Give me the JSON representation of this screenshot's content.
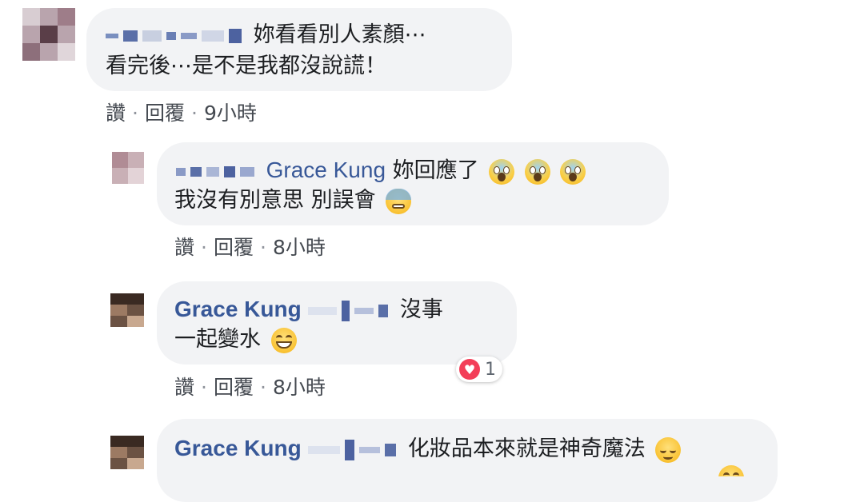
{
  "comments": [
    {
      "text_line1": "妳看看別人素顏⋯",
      "text_line2": "看完後⋯是不是我都沒說謊！",
      "like_label": "讚",
      "reply_label": "回覆",
      "time": "9小時"
    },
    {
      "mention": "Grace Kung",
      "text_line1": "妳回應了",
      "text_line2": "我沒有別意思 別誤會",
      "like_label": "讚",
      "reply_label": "回覆",
      "time": "8小時"
    },
    {
      "author": "Grace Kung",
      "text_line1": "沒事",
      "text_line2": "一起變水",
      "like_label": "讚",
      "reply_label": "回覆",
      "time": "8小時",
      "reaction_count": "1",
      "reaction_color": "#f33e58"
    },
    {
      "author": "Grace Kung",
      "text_line1": "化妝品本來就是神奇魔法"
    }
  ],
  "separator": "·",
  "colors": {
    "bubble": "#f2f3f5",
    "name": "#385898",
    "meta": "#444950"
  }
}
